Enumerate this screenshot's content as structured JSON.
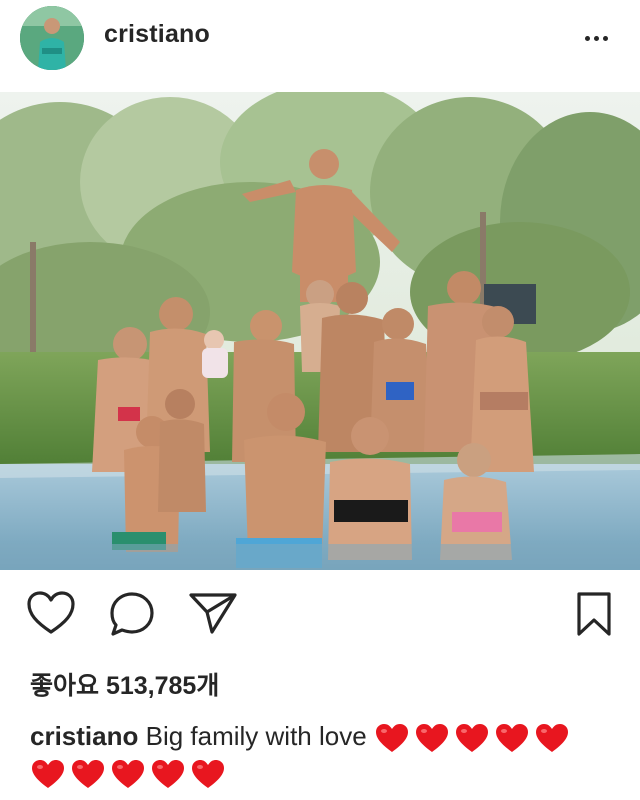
{
  "post": {
    "username": "cristiano",
    "likes_text": "좋아요 513,785개",
    "caption_text": "Big family with love",
    "heart_count_line1": 5,
    "heart_count_line2": 5
  },
  "icons": {
    "more": "more-options-icon",
    "like": "heart-outline-icon",
    "comment": "comment-bubble-icon",
    "share": "paper-plane-icon",
    "save": "bookmark-icon",
    "caption_emoji": "red-heart-emoji-icon"
  },
  "colors": {
    "text": "#262626",
    "heart_emoji": "#e8161f"
  }
}
